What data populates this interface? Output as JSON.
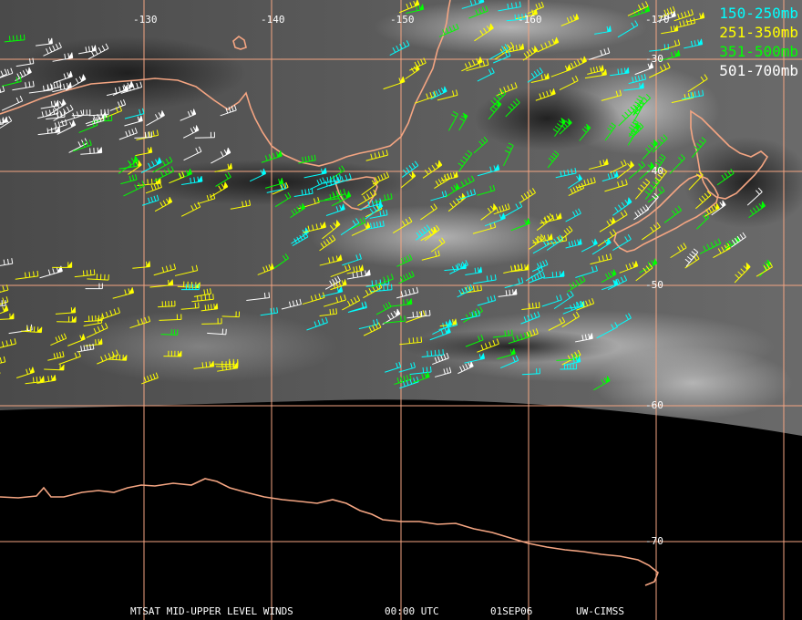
{
  "legend": [
    {
      "label": "150-250mb",
      "color": "#00ffff"
    },
    {
      "label": "251-350mb",
      "color": "#ffff00"
    },
    {
      "label": "351-500mb",
      "color": "#00ff00"
    },
    {
      "label": "501-700mb",
      "color": "#ffffff"
    }
  ],
  "longitudes": [
    "-130",
    "-140",
    "-150",
    "-160",
    "-170"
  ],
  "latitudes": [
    "-30",
    "-40",
    "-50",
    "-60",
    "-70"
  ],
  "footer": {
    "product": "MTSAT MID-UPPER LEVEL WINDS",
    "time": "00:00 UTC",
    "date": "01SEP06",
    "source": "UW-CIMSS"
  },
  "colors": {
    "grid": "#f4a582",
    "coast": "#f4a582",
    "background": "#000000"
  }
}
